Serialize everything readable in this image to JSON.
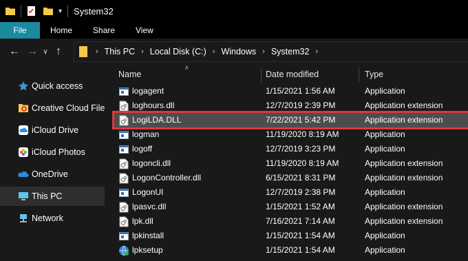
{
  "window": {
    "title": "System32"
  },
  "ribbon": {
    "tabs": [
      "File",
      "Home",
      "Share",
      "View"
    ]
  },
  "address": {
    "crumbs": [
      "This PC",
      "Local Disk (C:)",
      "Windows",
      "System32"
    ]
  },
  "sidebar": {
    "items": [
      {
        "label": "Quick access",
        "icon": "star-icon"
      },
      {
        "label": "Creative Cloud Files",
        "icon": "creative-cloud-folder-icon"
      },
      {
        "label": "iCloud Drive",
        "icon": "icloud-drive-icon"
      },
      {
        "label": "iCloud Photos",
        "icon": "icloud-photos-icon"
      },
      {
        "label": "OneDrive",
        "icon": "onedrive-icon"
      },
      {
        "label": "This PC",
        "icon": "computer-icon",
        "selected": true
      },
      {
        "label": "Network",
        "icon": "network-icon"
      }
    ]
  },
  "columns": {
    "name": "Name",
    "date": "Date modified",
    "type": "Type"
  },
  "files": [
    {
      "name": "logagent",
      "date": "1/15/2021 1:56 AM",
      "type": "Application",
      "icon": "app-icon"
    },
    {
      "name": "loghours.dll",
      "date": "12/7/2019 2:39 PM",
      "type": "Application extension",
      "icon": "dll-icon"
    },
    {
      "name": "LogiLDA.DLL",
      "date": "7/22/2021 5:42 PM",
      "type": "Application extension",
      "icon": "dll-icon",
      "selected": true
    },
    {
      "name": "logman",
      "date": "11/19/2020 8:19 AM",
      "type": "Application",
      "icon": "app-icon"
    },
    {
      "name": "logoff",
      "date": "12/7/2019 3:23 PM",
      "type": "Application",
      "icon": "app-icon"
    },
    {
      "name": "logoncli.dll",
      "date": "11/19/2020 8:19 AM",
      "type": "Application extension",
      "icon": "dll-icon"
    },
    {
      "name": "LogonController.dll",
      "date": "6/15/2021 8:31 PM",
      "type": "Application extension",
      "icon": "dll-icon"
    },
    {
      "name": "LogonUI",
      "date": "12/7/2019 2:38 PM",
      "type": "Application",
      "icon": "app-icon"
    },
    {
      "name": "lpasvc.dll",
      "date": "1/15/2021 1:52 AM",
      "type": "Application extension",
      "icon": "dll-icon"
    },
    {
      "name": "lpk.dll",
      "date": "7/16/2021 7:14 AM",
      "type": "Application extension",
      "icon": "dll-icon"
    },
    {
      "name": "lpkinstall",
      "date": "1/15/2021 1:54 AM",
      "type": "Application",
      "icon": "app-icon"
    },
    {
      "name": "lpksetup",
      "date": "1/15/2021 1:54 AM",
      "type": "Application",
      "icon": "installer-icon"
    }
  ],
  "colors": {
    "file_tab": "#1a8a9e",
    "highlight_border": "#e0363d",
    "selection": "#4d4d4d",
    "folder": "#f5c84c"
  }
}
